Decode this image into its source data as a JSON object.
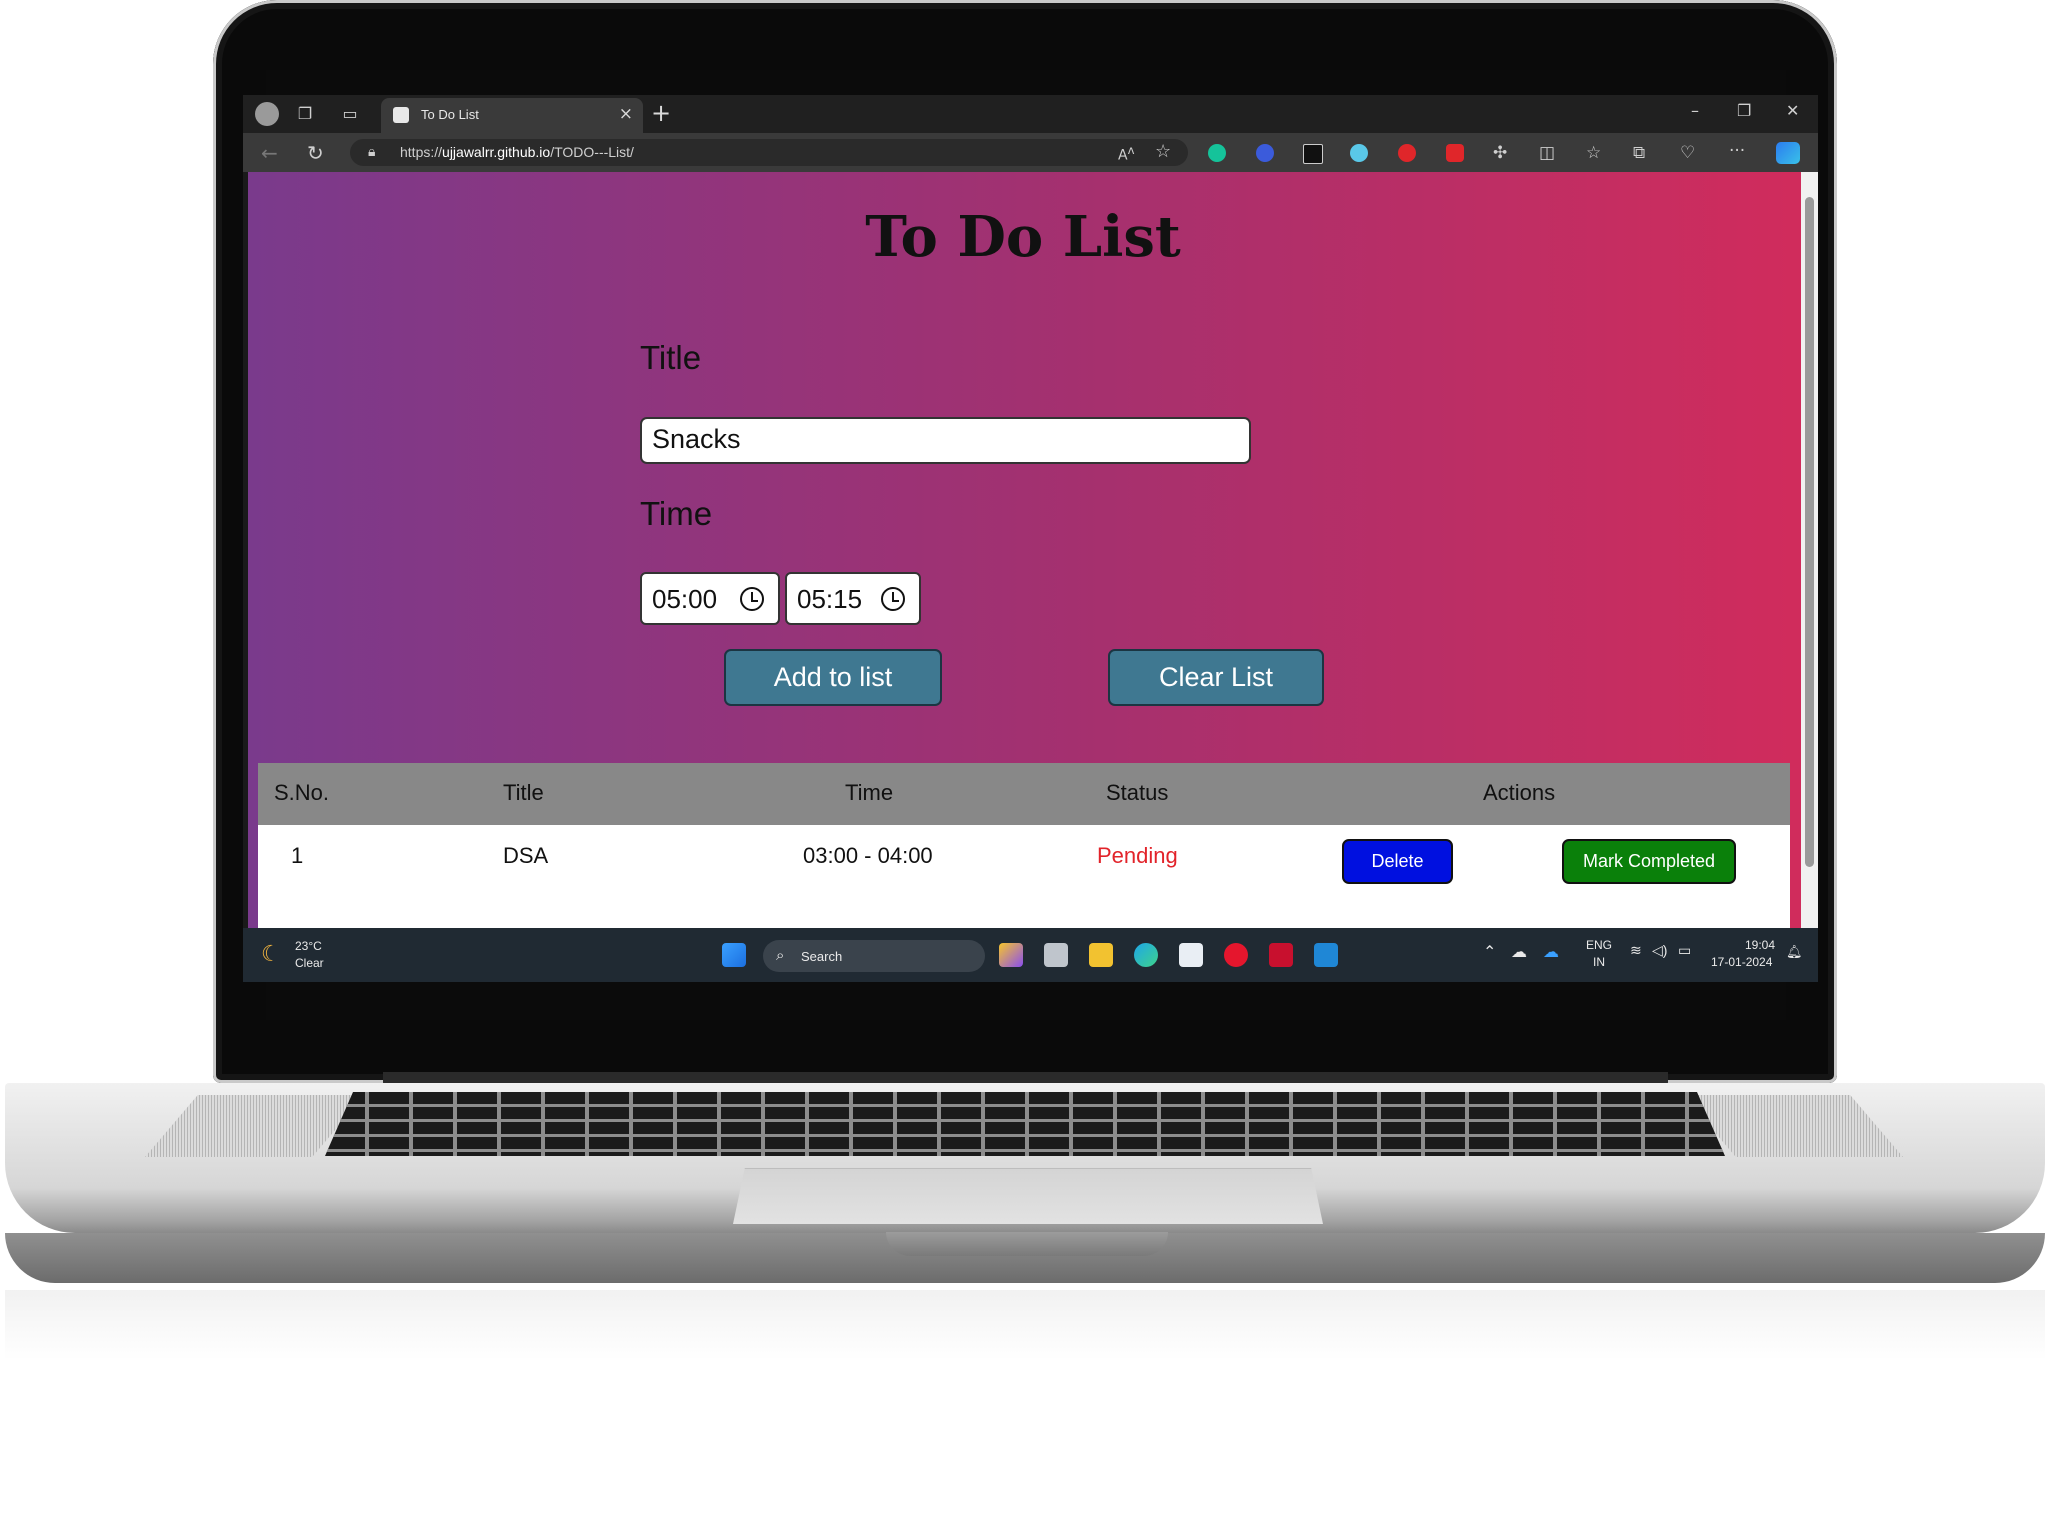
{
  "browser": {
    "tab_title": "To Do List",
    "url_prefix": "https://",
    "url_host": "ujjawalrr.github.io",
    "url_path": "/TODO---List/"
  },
  "app": {
    "heading": "To Do List",
    "title_label": "Title",
    "title_value": "Snacks",
    "time_label": "Time",
    "start_time": "05:00",
    "end_time": "05:15",
    "add_button": "Add to list",
    "clear_button": "Clear List"
  },
  "table": {
    "headers": [
      "S.No.",
      "Title",
      "Time",
      "Status",
      "Actions"
    ],
    "rows": [
      {
        "sno": "1",
        "title": "DSA",
        "time": "03:00 - 04:00",
        "status": "Pending",
        "delete": "Delete",
        "complete": "Mark Completed"
      }
    ]
  },
  "taskbar": {
    "weather_temp": "23°C",
    "weather_desc": "Clear",
    "search_label": "Search",
    "lang_top": "ENG",
    "lang_bottom": "IN",
    "clock_time": "19:04",
    "clock_date": "17-01-2024"
  },
  "colors": {
    "gradient_start": "#7a3a8c",
    "gradient_end": "#d12c5c",
    "button_primary": "#3f7891",
    "delete_button": "#0010e0",
    "complete_button": "#0a800a",
    "pending_status": "#e2232a"
  }
}
